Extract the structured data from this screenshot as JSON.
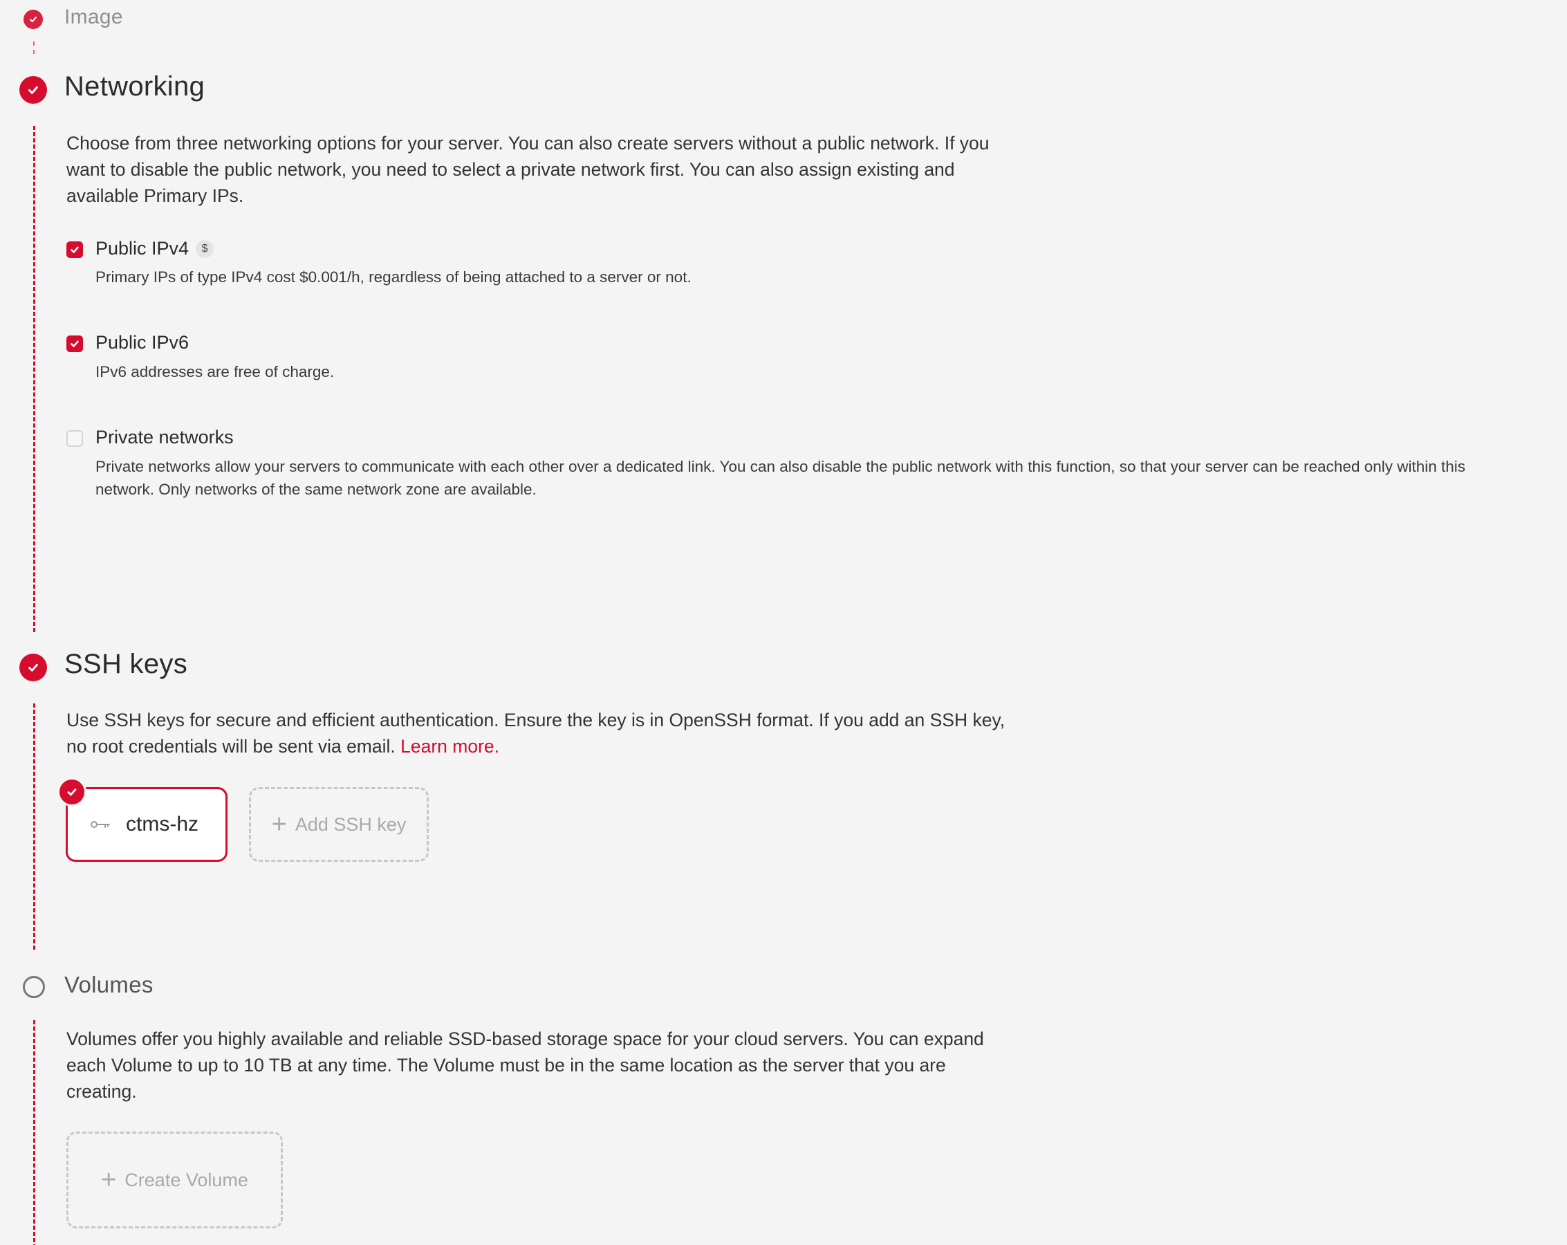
{
  "steps": {
    "image": {
      "title": "Image"
    },
    "networking": {
      "title": "Networking",
      "description": "Choose from three networking options for your server. You can also create servers without a public network. If you want to disable the public network, you need to select a private network first. You can also assign existing and available Primary IPs.",
      "options": [
        {
          "label": "Public IPv4",
          "badge": "$",
          "checked": true,
          "help": "Primary IPs of type IPv4 cost $0.001/h, regardless of being attached to a server or not."
        },
        {
          "label": "Public IPv6",
          "checked": true,
          "help": "IPv6 addresses are free of charge."
        },
        {
          "label": "Private networks",
          "checked": false,
          "help": "Private networks allow your servers to communicate with each other over a dedicated link. You can also disable the public network with this function, so that your server can be reached only within this network. Only networks of the same network zone are available."
        }
      ]
    },
    "ssh_keys": {
      "title": "SSH keys",
      "description": "Use SSH keys for secure and efficient authentication. Ensure the key is in OpenSSH format. If you add an SSH key, no root credentials will be sent via email. ",
      "learn_more": "Learn more.",
      "keys": [
        {
          "name": "ctms-hz",
          "selected": true
        }
      ],
      "add_label": "Add SSH key"
    },
    "volumes": {
      "title": "Volumes",
      "description": "Volumes offer you highly available and reliable SSD-based storage space for your cloud servers. You can expand each Volume to up to 10 TB at any time. The Volume must be in the same location as the server that you are creating.",
      "create_label": "Create Volume"
    }
  },
  "colors": {
    "accent": "#d50c2d",
    "background": "#f4f4f4",
    "muted_text": "#a9a9a9"
  },
  "icons": {
    "step_done": "check-circle-icon",
    "step_open": "empty-circle-icon",
    "key": "key-icon",
    "add": "plus-icon"
  }
}
